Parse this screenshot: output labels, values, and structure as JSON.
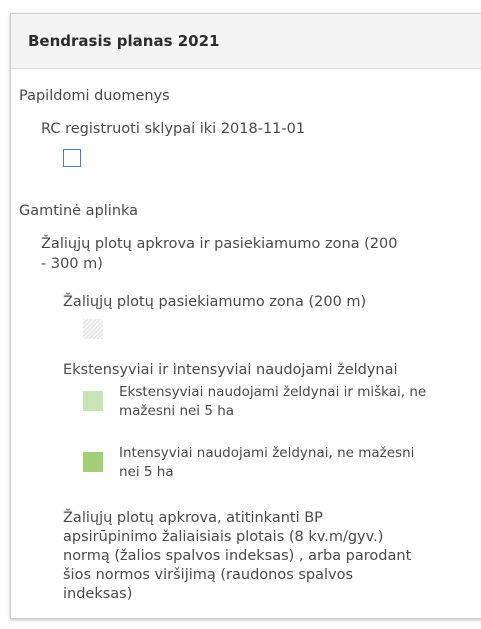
{
  "panel": {
    "title": "Bendrasis planas 2021"
  },
  "sections": {
    "papildomi": {
      "heading": "Papildomi duomenys",
      "layer_label": "RC registruoti sklypai iki 2018-11-01"
    },
    "gamtine": {
      "heading": "Gamtinė aplinka",
      "group_label_line1": "Žaliųjų plotų apkrova ir pasiekiamumo zona (200",
      "group_label_line2": "- 300 m)",
      "zone_label": "Žaliųjų plotų pasiekiamumo zona (200 m)",
      "green_heading": "Ekstensyviai ir intensyviai naudojami želdynai",
      "item1_line1": "Ekstensyviai naudojami želdynai ir miškai, ne",
      "item1_line2": "mažesni nei 5 ha",
      "item2_line1": "Intensyviai naudojami želdynai, ne mažesni",
      "item2_line2": "nei 5 ha",
      "load_line1": "Žaliųjų plotų apkrova, atitinkanti BP",
      "load_line2": "apsirūpinimo žaliaisiais plotais (8 kv.m/gyv.)",
      "load_line3": "normą (žalios spalvos indeksas) , arba parodant",
      "load_line4": "šios normos viršijimą (raudonos spalvos",
      "load_line5": "indeksas)"
    }
  },
  "colors": {
    "swatch_outline": "#4a7fc8",
    "extensive_green": "#c9e4b5",
    "intensive_green": "#a4cf79"
  }
}
